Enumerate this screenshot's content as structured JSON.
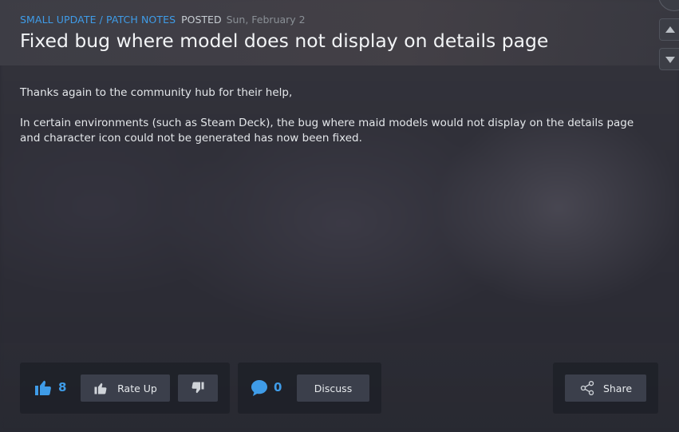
{
  "post": {
    "category": "SMALL UPDATE / PATCH NOTES",
    "posted_label": "POSTED",
    "date": "Sun, February 2",
    "title": "Fixed bug where model does not display on details page",
    "paragraphs": [
      "Thanks again to the community hub for their help,",
      "In certain environments (such as Steam Deck), the bug where maid models would not display on the details page and character icon could not be generated has now been fixed."
    ]
  },
  "actions": {
    "thumbs_up_count": "8",
    "rate_up_label": "Rate Up",
    "comment_count": "0",
    "discuss_label": "Discuss",
    "share_label": "Share"
  },
  "colors": {
    "accent": "#3f9ce8",
    "button_bg": "#3b3f4b",
    "panel_bg": "#1c1e26"
  },
  "icons": {
    "thumbs_up_count": "thumbs-up-icon",
    "rate_up": "thumbs-up-icon",
    "rate_down": "thumbs-down-icon",
    "comments": "comment-bubble-icon",
    "share": "share-icon",
    "scroll_up": "triangle-up-icon",
    "scroll_down": "triangle-down-icon"
  }
}
